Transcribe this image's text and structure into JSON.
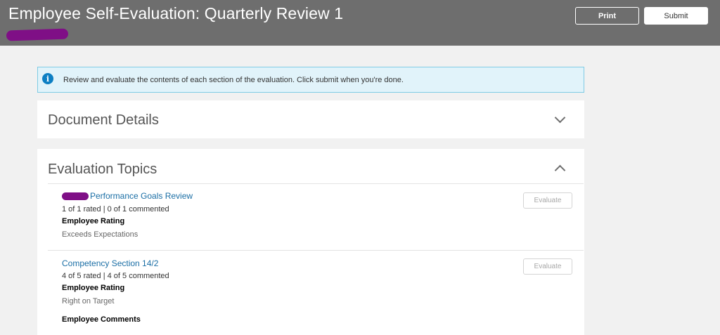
{
  "header": {
    "title": "Employee Self-Evaluation: Quarterly Review 1",
    "print_label": "Print",
    "submit_label": "Submit"
  },
  "info_banner": {
    "icon": "info-icon",
    "text": "Review and evaluate the contents of each section of the evaluation. Click submit when you're done."
  },
  "document_details": {
    "title": "Document Details",
    "expanded": false
  },
  "evaluation_topics": {
    "title": "Evaluation Topics",
    "expanded": true,
    "topics": [
      {
        "name": "Performance Goals Review",
        "status": "1 of 1 rated | 0 of 1 commented",
        "rating_label": "Employee Rating",
        "rating_value": "Exceeds Expectations",
        "evaluate_label": "Evaluate"
      },
      {
        "name": "Competency Section 14/2",
        "status": "4 of 5 rated | 4 of 5 commented",
        "rating_label": "Employee Rating",
        "rating_value": "Right on Target",
        "comments_label": "Employee Comments",
        "evaluate_label": "Evaluate"
      }
    ]
  },
  "colors": {
    "header_bg": "#6e6e6e",
    "link": "#1a6ea5",
    "info_bg": "#e1f3fa",
    "info_icon": "#0d7fc3",
    "redaction": "#7f0f86"
  }
}
